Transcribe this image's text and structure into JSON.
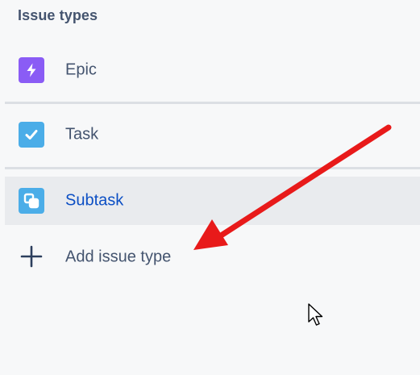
{
  "section": {
    "title": "Issue types"
  },
  "issue_types": [
    {
      "label": "Epic",
      "icon": "lightning-icon",
      "color": "#8a5cf5"
    },
    {
      "label": "Task",
      "icon": "checkbox-icon",
      "color": "#4bade8"
    },
    {
      "label": "Subtask",
      "icon": "subtask-icon",
      "color": "#4bade8"
    }
  ],
  "add_action": {
    "label": "Add issue type",
    "icon": "plus-icon"
  },
  "colors": {
    "background": "#f7f8f9",
    "selected_row": "#e9ebee",
    "selected_text": "#0c4fc4",
    "annotation_arrow": "#e81a1a"
  }
}
